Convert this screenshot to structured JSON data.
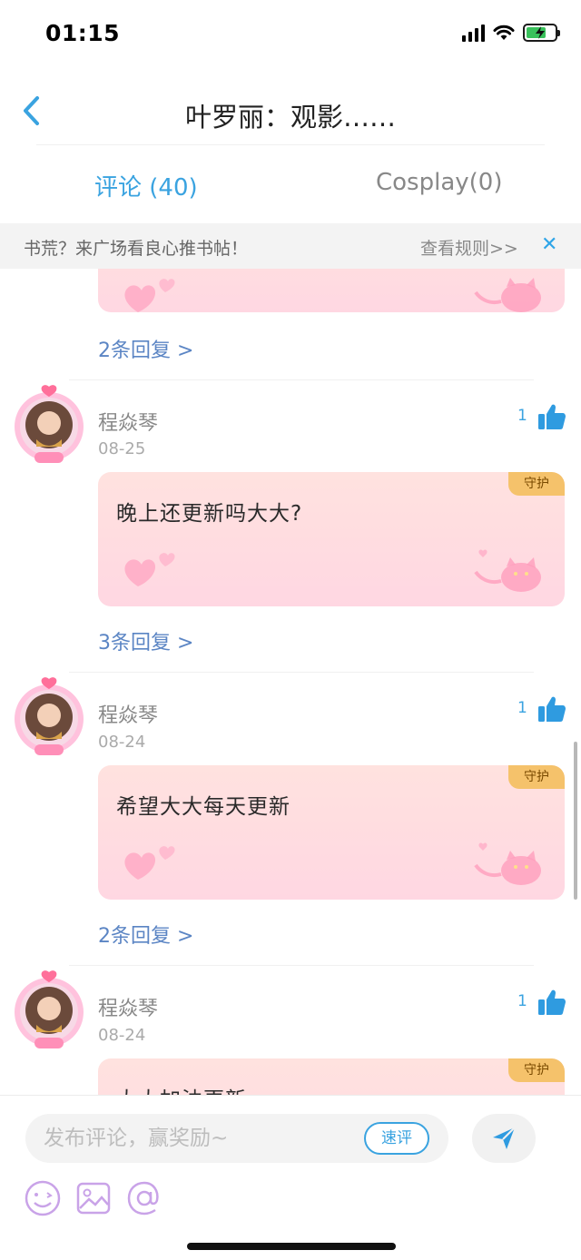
{
  "status": {
    "time": "01:15"
  },
  "nav": {
    "title": "叶罗丽：观影……"
  },
  "tabs": [
    {
      "label": "评论 (40)"
    },
    {
      "label": "Cosplay(0)"
    }
  ],
  "notice": {
    "text": "书荒？来广场看良心推书帖！",
    "link": "查看规则>>",
    "close": "✕"
  },
  "top_item": {
    "replies": "2条回复 >"
  },
  "comments": [
    {
      "user": "程焱琴",
      "date": "08-25",
      "likes": "1",
      "text": "晚上还更新吗大大?",
      "tag": "守护",
      "replies": "3条回复 >"
    },
    {
      "user": "程焱琴",
      "date": "08-24",
      "likes": "1",
      "text": "希望大大每天更新",
      "tag": "守护",
      "replies": "2条回复 >"
    },
    {
      "user": "程焱琴",
      "date": "08-24",
      "likes": "1",
      "text": "大大加油更新",
      "tag": "守护"
    }
  ],
  "input": {
    "placeholder": "发布评论，赢奖励~",
    "quick": "速评"
  },
  "colors": {
    "accent": "#3aa3e0",
    "reply_link": "#5b85c4",
    "guard_tag": "#f5c26b"
  },
  "icons": [
    "back-icon",
    "like-icon",
    "send-icon",
    "emoji-icon",
    "image-icon",
    "at-icon"
  ]
}
